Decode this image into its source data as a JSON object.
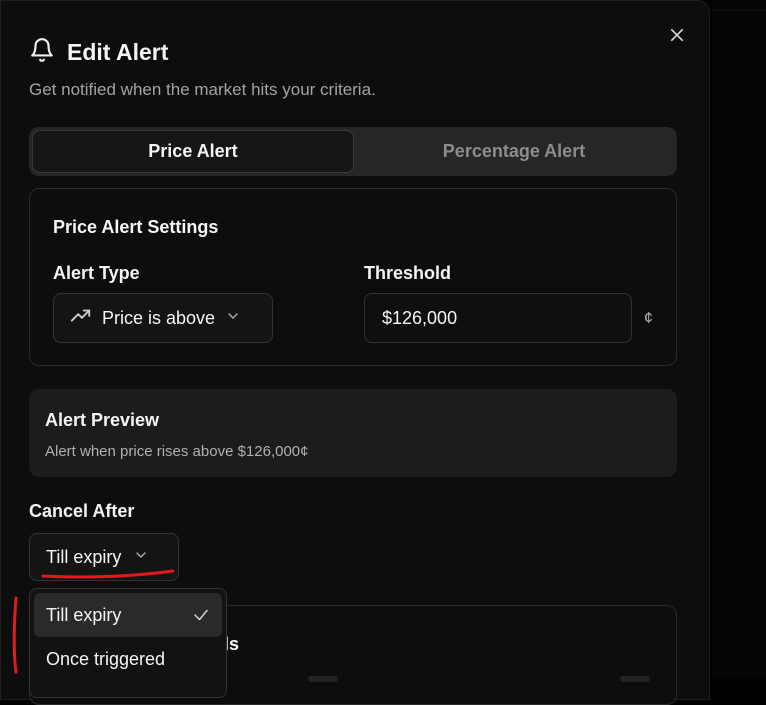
{
  "dialog": {
    "title": "Edit Alert",
    "subtitle": "Get notified when the market hits your criteria."
  },
  "tabs": [
    {
      "label": "Price Alert",
      "active": true
    },
    {
      "label": "Percentage Alert",
      "active": false
    }
  ],
  "settings": {
    "title": "Price Alert Settings",
    "alert_type_label": "Alert Type",
    "alert_type_value": "Price is above",
    "threshold_label": "Threshold",
    "threshold_value": "$126,000",
    "unit": "¢"
  },
  "preview": {
    "title": "Alert Preview",
    "text": "Alert when price rises above $126,000¢"
  },
  "cancel_after": {
    "label": "Cancel After",
    "selected": "Till expiry",
    "options": [
      {
        "label": "Till expiry",
        "selected": true
      },
      {
        "label": "Once triggered",
        "selected": false
      }
    ]
  },
  "obscured_card": {
    "title_fragment": "els"
  },
  "colors": {
    "annotation": "#e01b1b",
    "background": "#0d0d0d",
    "accent_tab": "#262626"
  },
  "icons": [
    "bell-icon",
    "close-icon",
    "trending-up-icon",
    "chevron-down-icon",
    "check-icon"
  ]
}
